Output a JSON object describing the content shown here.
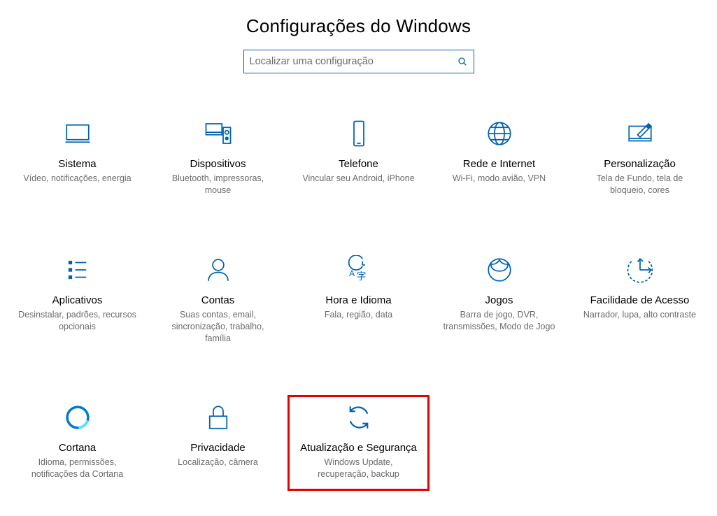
{
  "header": {
    "title": "Configurações do Windows"
  },
  "search": {
    "placeholder": "Localizar uma configuração",
    "value": ""
  },
  "tiles": [
    {
      "id": "system",
      "title": "Sistema",
      "desc": "Vídeo, notificações, energia"
    },
    {
      "id": "devices",
      "title": "Dispositivos",
      "desc": "Bluetooth, impressoras, mouse"
    },
    {
      "id": "phone",
      "title": "Telefone",
      "desc": "Vincular seu Android, iPhone"
    },
    {
      "id": "network",
      "title": "Rede e Internet",
      "desc": "Wi-Fi, modo avião, VPN"
    },
    {
      "id": "personalization",
      "title": "Personalização",
      "desc": "Tela de Fundo, tela de bloqueio, cores"
    },
    {
      "id": "apps",
      "title": "Aplicativos",
      "desc": "Desinstalar, padrões, recursos opcionais"
    },
    {
      "id": "accounts",
      "title": "Contas",
      "desc": "Suas contas, email, sincronização, trabalho, família"
    },
    {
      "id": "timelang",
      "title": "Hora e Idioma",
      "desc": "Fala, região, data"
    },
    {
      "id": "gaming",
      "title": "Jogos",
      "desc": "Barra de jogo, DVR, transmissões, Modo de Jogo"
    },
    {
      "id": "ease",
      "title": "Facilidade de Acesso",
      "desc": "Narrador, lupa, alto contraste"
    },
    {
      "id": "cortana",
      "title": "Cortana",
      "desc": "Idioma, permissões, notificações da Cortana"
    },
    {
      "id": "privacy",
      "title": "Privacidade",
      "desc": "Localização, câmera"
    },
    {
      "id": "update",
      "title": "Atualização e Segurança",
      "desc": "Windows Update, recuperação, backup",
      "highlighted": true
    }
  ],
  "colors": {
    "accent": "#0063b1",
    "highlight": "#e60000",
    "muted": "#6b6b6b"
  }
}
